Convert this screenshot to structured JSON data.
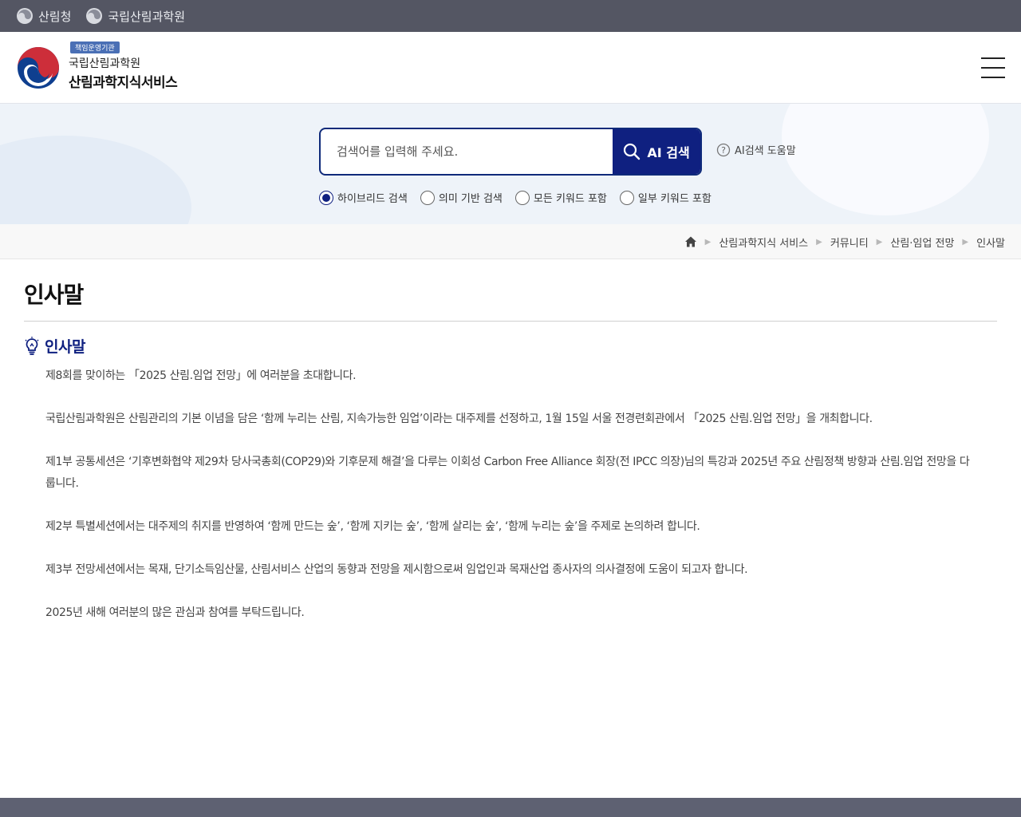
{
  "topbar": {
    "links": [
      {
        "label": "산림청"
      },
      {
        "label": "국립산림과학원"
      }
    ]
  },
  "header": {
    "badge": "책임운영기관",
    "org_name": "국립산림과학원",
    "service_name": "산림과학지식서비스",
    "colors": {
      "emblem_red": "#cd2e3a",
      "emblem_blue": "#0f3f8f"
    }
  },
  "search": {
    "placeholder": "검색어를 입력해 주세요.",
    "button_label": "AI 검색",
    "help_label": "AI검색 도움말",
    "options": [
      {
        "label": "하이브리드 검색",
        "checked": true
      },
      {
        "label": "의미 기반 검색",
        "checked": false
      },
      {
        "label": "모든 키워드 포함",
        "checked": false
      },
      {
        "label": "일부 키워드 포함",
        "checked": false
      }
    ],
    "accent_color": "#0f2080"
  },
  "breadcrumb": {
    "items": [
      {
        "label": "산림과학지식 서비스"
      },
      {
        "label": "커뮤니티"
      },
      {
        "label": "산림·임업 전망"
      },
      {
        "label": "인사말"
      }
    ]
  },
  "content": {
    "page_title": "인사말",
    "section_title": "인사말",
    "paragraphs": [
      "제8회를 맞이하는 「2025 산림.임업 전망」에 여러분을 초대합니다.",
      "국립산림과학원은 산림관리의 기본 이념을 담은 ‘함께 누리는 산림, 지속가능한 임업’이라는 대주제를 선정하고, 1월 15일 서울 전경련회관에서 「2025 산림.임업 전망」을 개최합니다.",
      "제1부 공통세션은 ‘기후변화협약 제29차 당사국총회(COP29)와 기후문제 해결’을 다루는 이회성 Carbon Free Alliance 회장(전 IPCC 의장)님의 특강과 2025년 주요 산림정책 방향과 산림.임업 전망을 다룹니다.",
      "제2부 특별세션에서는 대주제의 취지를 반영하여 ‘함께 만드는 숲’, ‘함께 지키는 숲’, ‘함께 살리는 숲’, ‘함께 누리는 숲’을 주제로 논의하려 합니다.",
      "제3부 전망세션에서는 목재, 단기소득임산물, 산림서비스 산업의 동향과 전망을 제시함으로써 임업인과 목재산업 종사자의 의사결정에 도움이 되고자 합니다.",
      "2025년 새해 여러분의 많은 관심과 참여를 부탁드립니다."
    ]
  }
}
